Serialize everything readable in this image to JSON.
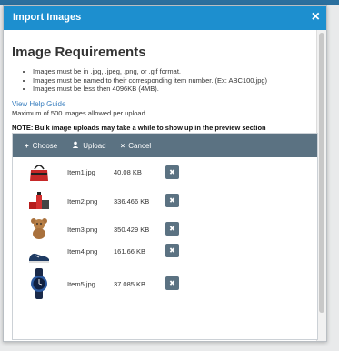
{
  "dialog": {
    "title": "Import Images",
    "close_glyph": "×",
    "heading": "Image Requirements",
    "requirements": [
      "Images must be in .jpg, .jpeg, .png, or .gif format.",
      "Images must be named to their corresponding item number. (Ex: ABC100.jpg)",
      "Images must be less then 4096KB (4MB)."
    ],
    "help_link": "View Help Guide",
    "max_note": "Maximum of 500 images allowed per upload.",
    "note": "NOTE: Bulk image uploads may take a while to show up in the preview section"
  },
  "toolbar": {
    "choose_icon": "+",
    "choose_label": "Choose",
    "upload_icon": "👤",
    "upload_label": "Upload",
    "cancel_icon": "×",
    "cancel_label": "Cancel"
  },
  "files": [
    {
      "name": "Item1.jpg",
      "size": "40.08 KB",
      "thumb": "handbag-icon"
    },
    {
      "name": "Item2.png",
      "size": "336.466 KB",
      "thumb": "cosmetics-set-icon"
    },
    {
      "name": "Item3.png",
      "size": "350.429 KB",
      "thumb": "teddy-bear-icon"
    },
    {
      "name": "Item4.png",
      "size": "161.66 KB",
      "thumb": "sneaker-icon"
    },
    {
      "name": "Item5.jpg",
      "size": "37.085 KB",
      "thumb": "wristwatch-icon"
    }
  ],
  "remove_glyph": "✖",
  "colors": {
    "titlebar": "#1d8fcf",
    "toolbar": "#5b7282",
    "link": "#3a7fbf"
  }
}
